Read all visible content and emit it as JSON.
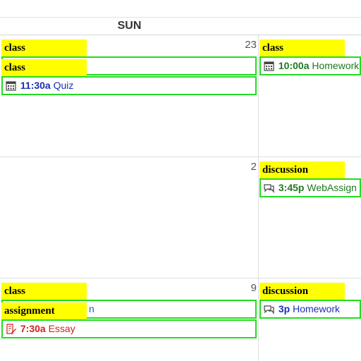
{
  "header": {
    "day": "SUN"
  },
  "rows": [
    {
      "date": "23",
      "left_events": [
        {
          "tag": "class",
          "time": "",
          "title": ""
        },
        {
          "tag": "class",
          "time": "11:30a",
          "title": "Quiz",
          "icon": "calendar-icon"
        }
      ],
      "right_events": [
        {
          "tag": "class",
          "time": "10:00a",
          "title": "Homework",
          "icon": "calendar-icon"
        }
      ]
    },
    {
      "date": "2",
      "right_events": [
        {
          "tag": "discussion",
          "time": "3:45p",
          "title": "WebAssign",
          "icon": "discussion-icon"
        }
      ]
    },
    {
      "date": "9",
      "left_events": [
        {
          "tag": "class",
          "time": "",
          "title": "n"
        },
        {
          "tag": "assignment",
          "time": "7:30a",
          "title": "Essay",
          "icon": "assignment-icon"
        }
      ],
      "right_events": [
        {
          "tag": "discussion",
          "time": "3p",
          "title": "Homework",
          "icon": "discussion-icon"
        }
      ]
    }
  ],
  "colors": {
    "tag_bg": "#ffff00",
    "event_border": "#22dd22"
  }
}
